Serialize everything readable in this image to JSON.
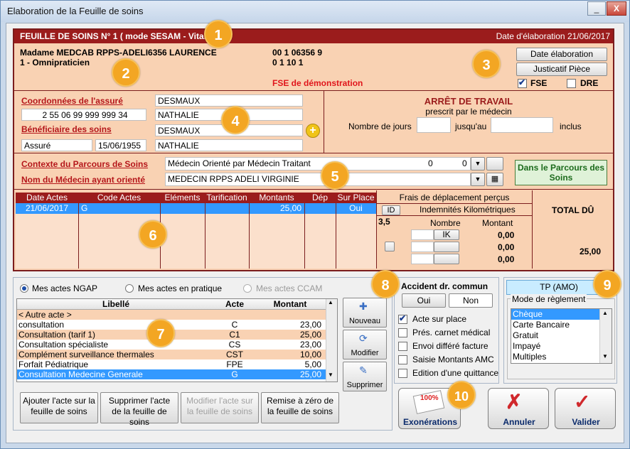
{
  "window": {
    "title": "Elaboration de la Feuille de soins",
    "minimize": "_",
    "close": "X"
  },
  "header": {
    "title": "FEUILLE DE SOINS  N° 1 ( mode SESAM - Vitalé )",
    "date_label": "Date d'élaboration 21/06/2017"
  },
  "practitioner": {
    "name": "Madame MEDCAB RPPS-ADELI6356 LAURENCE",
    "specialty": "1 - Omnipraticien",
    "code1": "00 1 06356 9",
    "code2": "0 1 10 1",
    "demo": "FSE de démonstration"
  },
  "buttons_top": {
    "date_elab": "Date élaboration",
    "justif": "Justicatif Pièce",
    "fse": "FSE",
    "dre": "DRE"
  },
  "insured": {
    "coord_label": "Coordonnées de l'assuré",
    "nom": "DESMAUX",
    "nir": "2 55 06 99 999 999 34",
    "prenom": "NATHALIE",
    "benef_label": "Bénéficiaire des soins",
    "benef_nom": "DESMAUX",
    "qualite": "Assuré",
    "naissance": "15/06/1955",
    "benef_prenom": "NATHALIE"
  },
  "arret": {
    "title": "ARRÊT DE TRAVAIL",
    "subtitle": "prescrit par le médecin",
    "jours_label": "Nombre de jours",
    "jusqu_label": "jusqu'au",
    "inclus_label": "inclus"
  },
  "parcours": {
    "contexte_label": "Contexte du Parcours de Soins",
    "contexte_value": "Médecin Orienté par Médecin Traitant",
    "contexte_n1": "0",
    "contexte_n2": "0",
    "medecin_label": "Nom du Médecin ayant orienté",
    "medecin_value": "MEDECIN RPPS ADELI   VIRGINIE",
    "dans_parcours": "Dans le Parcours des Soins"
  },
  "actes_table": {
    "headers": [
      "Date Actes",
      "Code Actes",
      "Eléments",
      "Tarification",
      "Montants",
      "Dép",
      "Sur Place"
    ],
    "rows": [
      {
        "date": "21/06/2017",
        "code": "G",
        "elements": "",
        "tarif": "",
        "montant": "25,00",
        "dep": "",
        "surplace": "Oui"
      }
    ]
  },
  "frais": {
    "title": "Frais de déplacement perçus",
    "id_btn": "ID",
    "ik_title": "Indemnités Kilométriques",
    "value": "3,5",
    "nombre_label": "Nombre",
    "montant_label": "Montant",
    "ik_btn": "IK",
    "montants": [
      "0,00",
      "0,00",
      "0,00"
    ],
    "total_label": "TOTAL DÛ",
    "total_value": "25,00"
  },
  "ngap": {
    "radio1": "Mes actes NGAP",
    "radio2": "Mes actes en pratique",
    "radio3": "Mes actes CCAM",
    "col_libelle": "Libellé",
    "col_acte": "Acte",
    "col_montant": "Montant",
    "rows": [
      {
        "libelle": "< Autre acte >",
        "acte": "",
        "montant": ""
      },
      {
        "libelle": "consultation",
        "acte": "C",
        "montant": "23,00"
      },
      {
        "libelle": "Consultation (tarif 1)",
        "acte": "C1",
        "montant": "25,00"
      },
      {
        "libelle": "Consultation spécialiste",
        "acte": "CS",
        "montant": "23,00"
      },
      {
        "libelle": "Complément surveillance thermales",
        "acte": "CST",
        "montant": "10,00"
      },
      {
        "libelle": "Forfait Pédiatrique",
        "acte": "FPE",
        "montant": "5,00"
      },
      {
        "libelle": "Consultation Medecine Generale",
        "acte": "G",
        "montant": "25,00"
      }
    ],
    "nouveau": "Nouveau",
    "modifier": "Modifier",
    "supprimer": "Supprimer"
  },
  "bottom_buttons": {
    "ajouter": "Ajouter l'acte sur la feuille de soins",
    "supprimer": "Supprimer l'acte de la feuille de soins",
    "modifier": "Modifier l'acte sur la feuille de soins",
    "remise": "Remise à zéro de la feuille de soins"
  },
  "accident": {
    "title": "Accident dr. commun",
    "oui": "Oui",
    "non": "Non"
  },
  "options": [
    {
      "label": "Acte sur place",
      "checked": true
    },
    {
      "label": "Prés. carnet médical",
      "checked": false
    },
    {
      "label": "Envoi différé facture",
      "checked": false
    },
    {
      "label": "Saisie Montants AMC",
      "checked": false
    },
    {
      "label": "Edition d'une quittance",
      "checked": false
    }
  ],
  "reglement": {
    "tp_label": "TP (AMO)",
    "mode_label": "Mode de règlement",
    "items": [
      "Chèque",
      "Carte Bancaire",
      "Gratuit",
      "Impayé",
      "Multiples"
    ]
  },
  "actions": {
    "exonerations": "Exonérations",
    "annuler": "Annuler",
    "valider": "Valider",
    "stamp": "100%"
  },
  "badges": [
    "1",
    "2",
    "3",
    "4",
    "5",
    "6",
    "7",
    "8",
    "9",
    "10"
  ],
  "colors": {
    "header_red": "#9b1c1c",
    "peach": "#f9d2b3",
    "badge": "#f3a623",
    "selection": "#3399ff"
  }
}
